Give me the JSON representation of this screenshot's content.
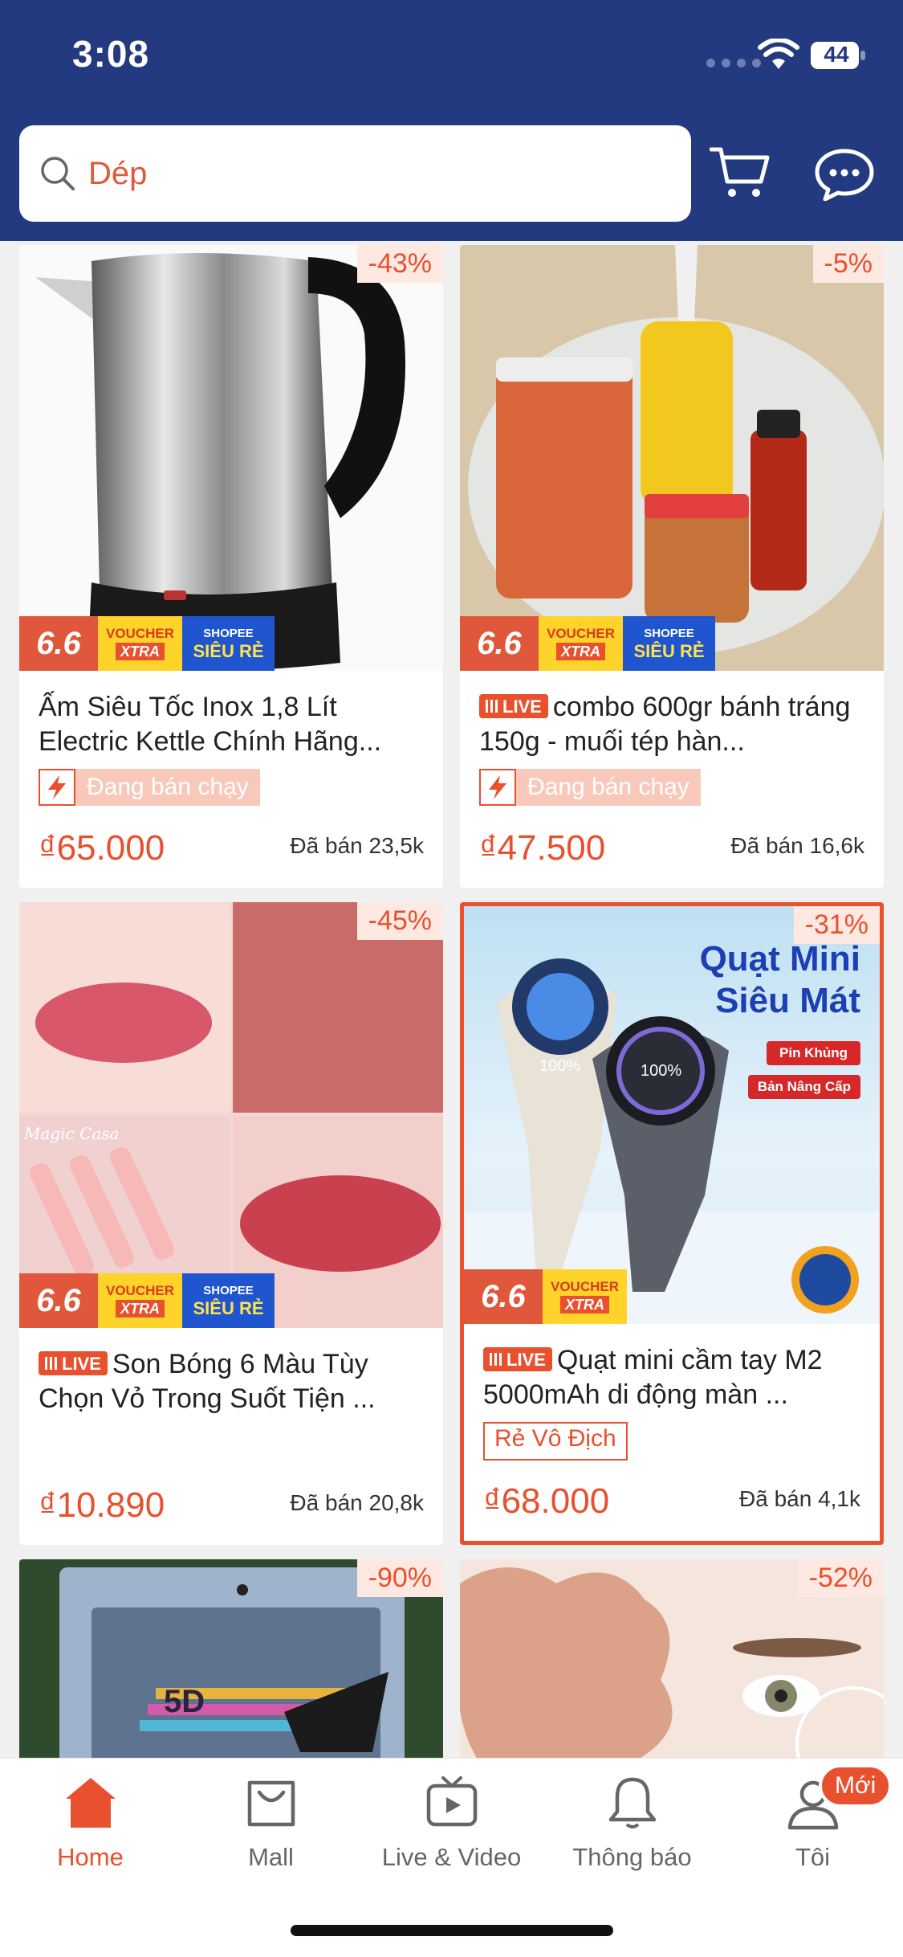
{
  "status_bar": {
    "time": "3:08",
    "battery": "44"
  },
  "search": {
    "query": "Dép"
  },
  "products": [
    {
      "discount": "-43%",
      "badges": {
        "six_six": "6.6",
        "voucher_top": "VOUCHER",
        "voucher_bottom": "XTRA",
        "shopee_top": "SHOPEE",
        "shopee_bottom": "SIÊU RẺ"
      },
      "title": "Ấm Siêu Tốc Inox 1,8 Lít Electric Kettle Chính Hãng...",
      "tag": "Đang bán chạy",
      "price": "₫65.000",
      "sold": "Đã bán 23,5k"
    },
    {
      "discount": "-5%",
      "badges": {
        "six_six": "6.6",
        "voucher_top": "VOUCHER",
        "voucher_bottom": "XTRA",
        "shopee_top": "SHOPEE",
        "shopee_bottom": "SIÊU RẺ"
      },
      "live": "LIVE",
      "title": "combo 600gr bánh tráng 150g - muối tép hàn...",
      "tag": "Đang bán chạy",
      "price": "₫47.500",
      "sold": "Đã bán 16,6k"
    },
    {
      "discount": "-45%",
      "badges": {
        "six_six": "6.6",
        "voucher_top": "VOUCHER",
        "voucher_bottom": "XTRA",
        "shopee_top": "SHOPEE",
        "shopee_bottom": "SIÊU RẺ"
      },
      "live": "LIVE",
      "title": "Son Bóng 6 Màu Tùy Chọn Vỏ Trong Suốt Tiện ...",
      "price": "₫10.890",
      "sold": "Đã bán 20,8k",
      "image_text": "Magic Casa"
    },
    {
      "discount": "-31%",
      "badges": {
        "six_six": "6.6",
        "voucher_top": "VOUCHER",
        "voucher_bottom": "XTRA"
      },
      "live": "LIVE",
      "title": "Quạt mini cầm tay M2 5000mAh di động  màn ...",
      "tag": "Rẻ Vô Địch",
      "price": "₫68.000",
      "sold": "Đã bán 4,1k",
      "image_text": {
        "headline1": "Quạt Mini",
        "headline2": "Siêu Mát",
        "pill1": "Pin Khủng",
        "pill2": "Bản Nâng Cấp",
        "display1": "100%",
        "display2": "100%"
      }
    },
    {
      "discount": "-90%",
      "image_text": "5D"
    },
    {
      "discount": "-52%"
    }
  ],
  "nav": {
    "home": "Home",
    "mall": "Mall",
    "live": "Live & Video",
    "notify": "Thông báo",
    "me": "Tôi",
    "badge": "Mới"
  },
  "colors": {
    "header": "#233a80",
    "accent": "#e8502e"
  }
}
